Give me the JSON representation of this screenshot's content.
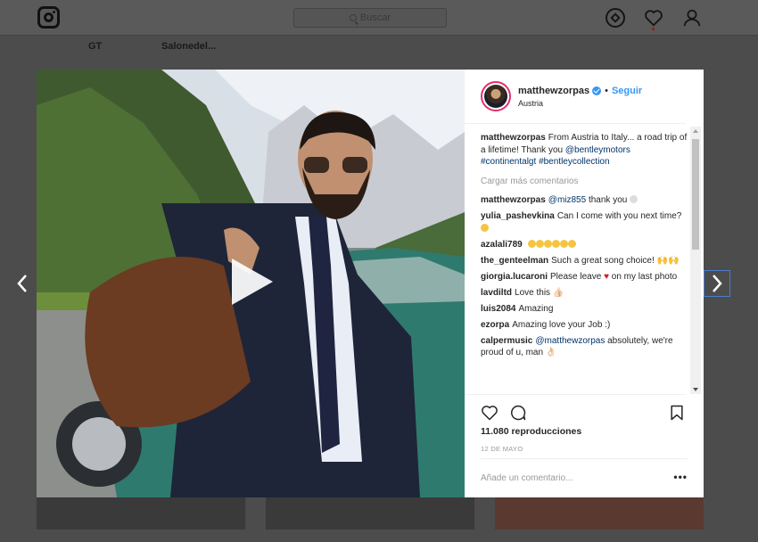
{
  "background": {
    "search_placeholder": "Buscar",
    "highlights": [
      "GT",
      "Salonedel..."
    ]
  },
  "post": {
    "username": "matthewzorpas",
    "separator": "•",
    "follow_label": "Seguir",
    "location": "Austria",
    "caption_user": "matthewzorpas",
    "caption_text": "From Austria to Italy... a road trip of a lifetime! Thank you",
    "caption_mention": "@bentleymotors",
    "caption_tag1": "#continentalgt",
    "caption_tag2": "#bentleycollection",
    "load_more": "Cargar más comentarios",
    "comments": [
      {
        "user": "matthewzorpas",
        "mention": "@miz855",
        "text": "thank you"
      },
      {
        "user": "yulia_pashevkina",
        "text": "Can I come with you next time?"
      },
      {
        "user": "azalali789",
        "text": ""
      },
      {
        "user": "the_genteelman",
        "text": "Such a great song choice! 🙌🙌"
      },
      {
        "user": "giorgia.lucaroni",
        "text_before": "Please leave",
        "heart": "♥",
        "text_after": "on my last photo"
      },
      {
        "user": "lavdiltd",
        "text": "Love this 👍🏻"
      },
      {
        "user": "luis2084",
        "text": "Amazing"
      },
      {
        "user": "ezorpa",
        "text": "Amazing love your Job :)"
      },
      {
        "user": "calpermusic",
        "mention": "@matthewzorpas",
        "text": "absolutely, we're proud of u, man 👌🏻"
      }
    ],
    "views": "11.080 reproducciones",
    "date": "12 DE MAYO",
    "comment_placeholder": "Añade un comentario...",
    "more_label": "•••"
  },
  "colors": {
    "accent": "#3897f0",
    "link": "#003569",
    "overlay": "#4c4c4c"
  },
  "icons": [
    "instagram-logo-icon",
    "search-icon",
    "compass-icon",
    "heart-icon",
    "user-icon",
    "chevron-left-icon",
    "chevron-right-icon",
    "play-icon",
    "like-icon",
    "comment-icon",
    "bookmark-icon",
    "verified-icon"
  ]
}
